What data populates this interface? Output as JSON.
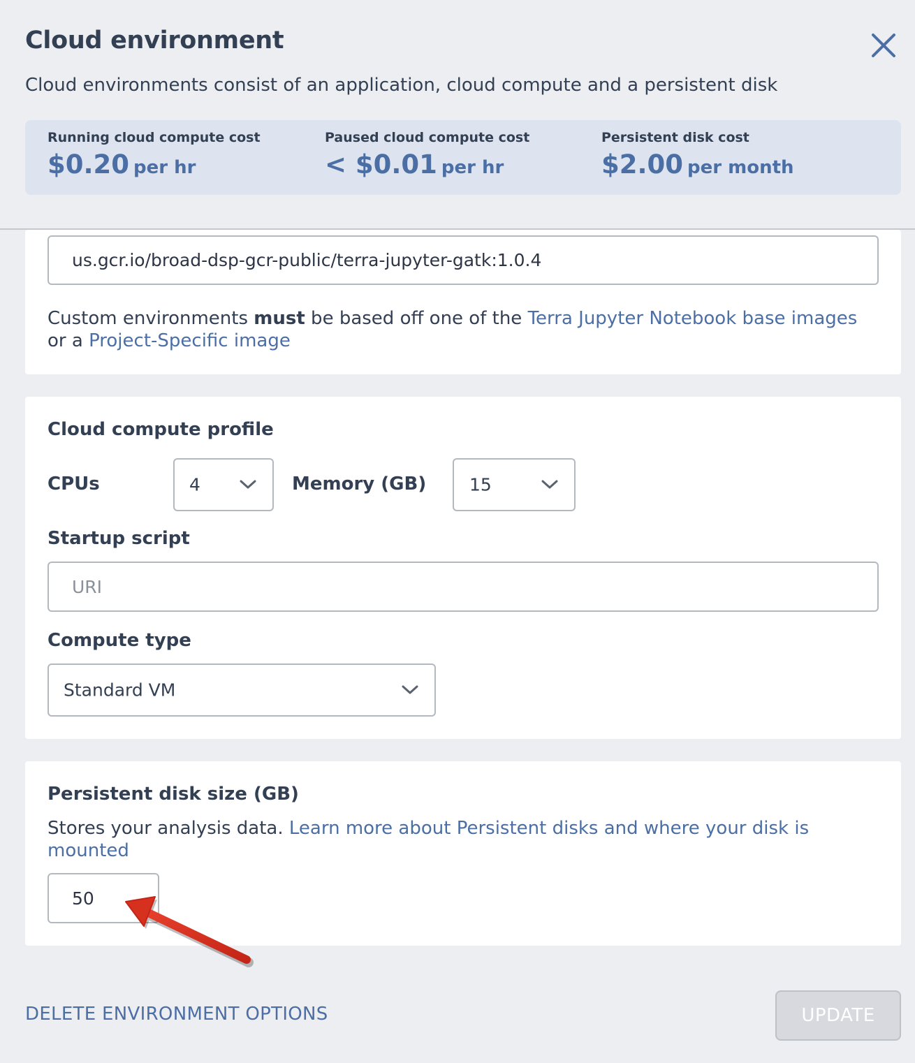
{
  "header": {
    "title": "Cloud environment",
    "subtitle": "Cloud environments consist of an application, cloud compute and a persistent disk",
    "close_icon": "close-icon"
  },
  "costs": [
    {
      "label": "Running cloud compute cost",
      "amount": "$0.20",
      "unit": "per hr"
    },
    {
      "label": "Paused cloud compute cost",
      "amount": "< $0.01",
      "unit": "per hr"
    },
    {
      "label": "Persistent disk cost",
      "amount": "$2.00",
      "unit": "per month"
    }
  ],
  "custom_image": {
    "value": "us.gcr.io/broad-dsp-gcr-public/terra-jupyter-gatk:1.0.4",
    "note_prefix": "Custom environments ",
    "note_bold": "must",
    "note_mid": " be based off one of the ",
    "note_link1": "Terra Jupyter Notebook base images",
    "note_or": " or a ",
    "note_link2": "Project-Specific image"
  },
  "compute_profile": {
    "title": "Cloud compute profile",
    "cpus_label": "CPUs",
    "cpus_value": "4",
    "memory_label": "Memory (GB)",
    "memory_value": "15",
    "startup_label": "Startup script",
    "startup_placeholder": "URI",
    "compute_type_label": "Compute type",
    "compute_type_value": "Standard VM"
  },
  "disk": {
    "title": "Persistent disk size (GB)",
    "desc": "Stores your analysis data. ",
    "link": "Learn more about Persistent disks and where your disk is mounted",
    "value": "50"
  },
  "footer": {
    "delete_label": "DELETE ENVIRONMENT OPTIONS",
    "update_label": "UPDATE"
  },
  "colors": {
    "accent": "#4b6fa5",
    "text": "#333f52",
    "cost_bg": "#dde4ef",
    "annotation_arrow": "#d6301f"
  }
}
